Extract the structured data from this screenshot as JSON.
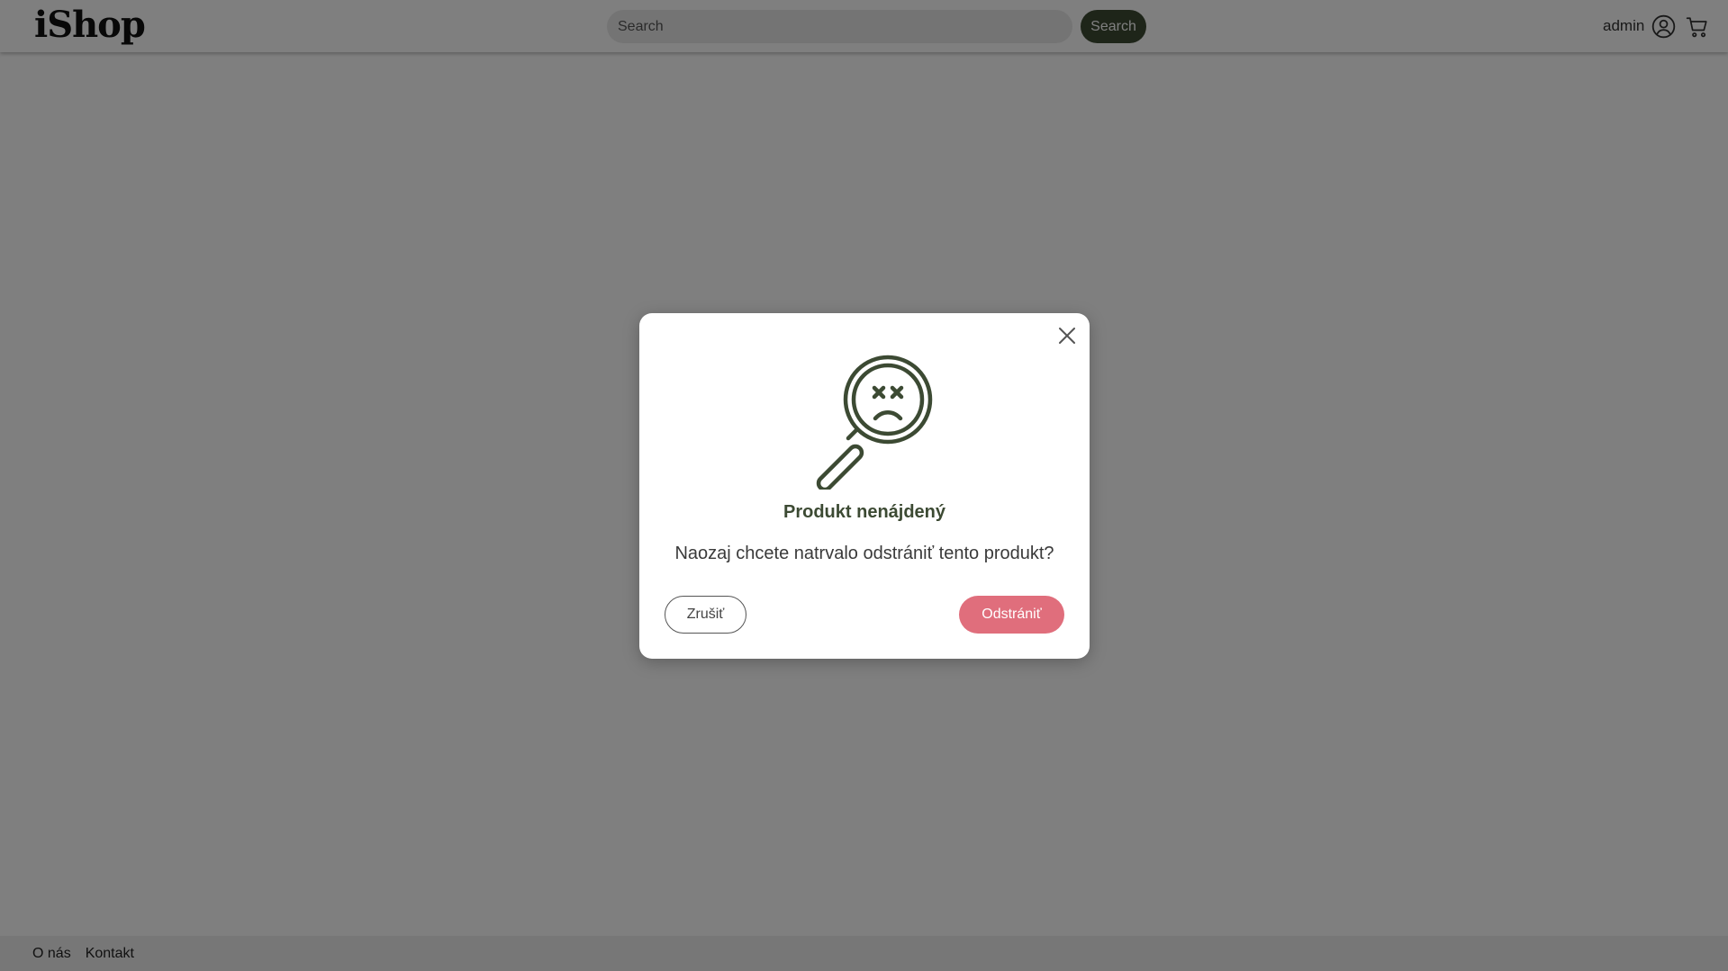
{
  "header": {
    "logo": "iShop",
    "search": {
      "placeholder": "Search",
      "value": ""
    },
    "search_button": "Search",
    "user": {
      "name": "admin",
      "icon": "user-circle-icon"
    },
    "cart_icon": "cart-icon"
  },
  "footer": {
    "links": [
      "O nás",
      "Kontakt"
    ]
  },
  "modal": {
    "illustration": "sad-magnifier-icon",
    "title": "Produkt nenájdený",
    "message": "Naozaj chcete natrvalo odstrániť tento produkt?",
    "cancel_label": "Zrušiť",
    "delete_label": "Odstrániť",
    "close_icon": "close-icon"
  },
  "colors": {
    "primary": "#3c4a33",
    "danger": "#e06e7c",
    "overlay": "rgba(0,0,0,0.5)"
  }
}
